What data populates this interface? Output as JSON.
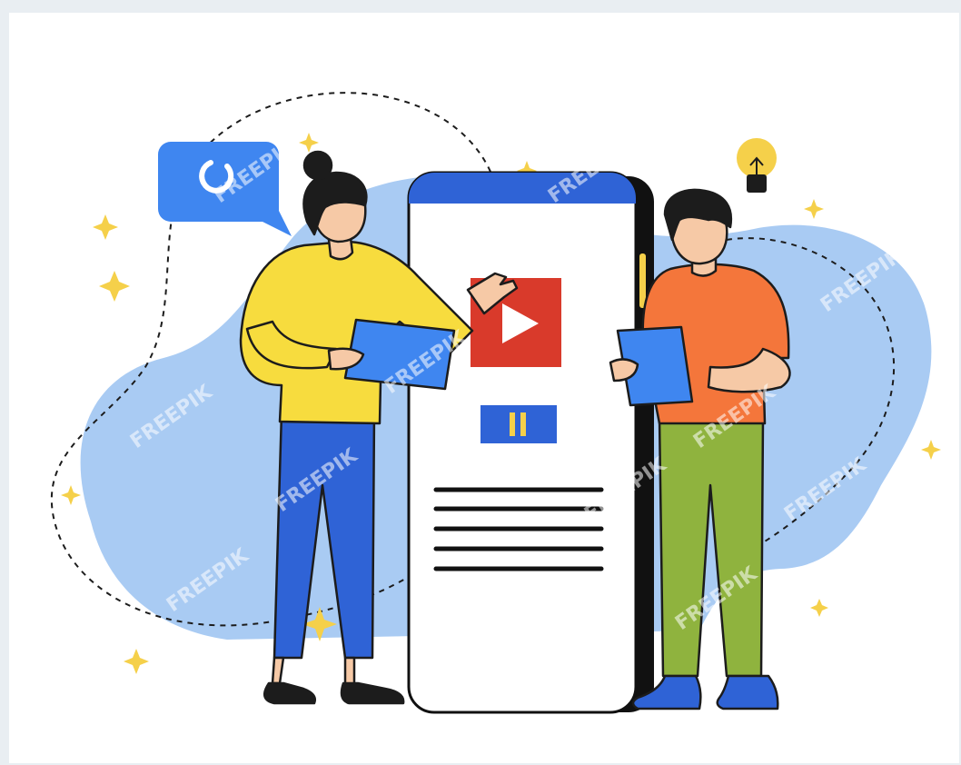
{
  "illustration": {
    "watermark_text": "FREEPIK",
    "colors": {
      "blob": "#a9cbf3",
      "phone_header": "#2f63d6",
      "phone_body": "#ffffff",
      "phone_frame": "#111111",
      "play_button": "#d93a2b",
      "pause_button": "#2f63d6",
      "pause_bars": "#f5d04a",
      "speech_bubble": "#3f86f0",
      "sparkle": "#f5d04a",
      "woman_sweater": "#f7dc3e",
      "woman_pants": "#2f63d6",
      "man_shirt": "#f4763b",
      "man_pants": "#8fb33e",
      "shoes_man": "#2f63d6",
      "shoes_woman": "#1c1c1c",
      "tablet": "#3f86f0",
      "skin": "#f6c9a6",
      "hair": "#1c1c1c"
    },
    "icons": [
      "speech-bubble-icon",
      "loading-spinner-icon",
      "lightbulb-icon",
      "play-icon",
      "pause-icon",
      "sparkle-icon"
    ]
  }
}
